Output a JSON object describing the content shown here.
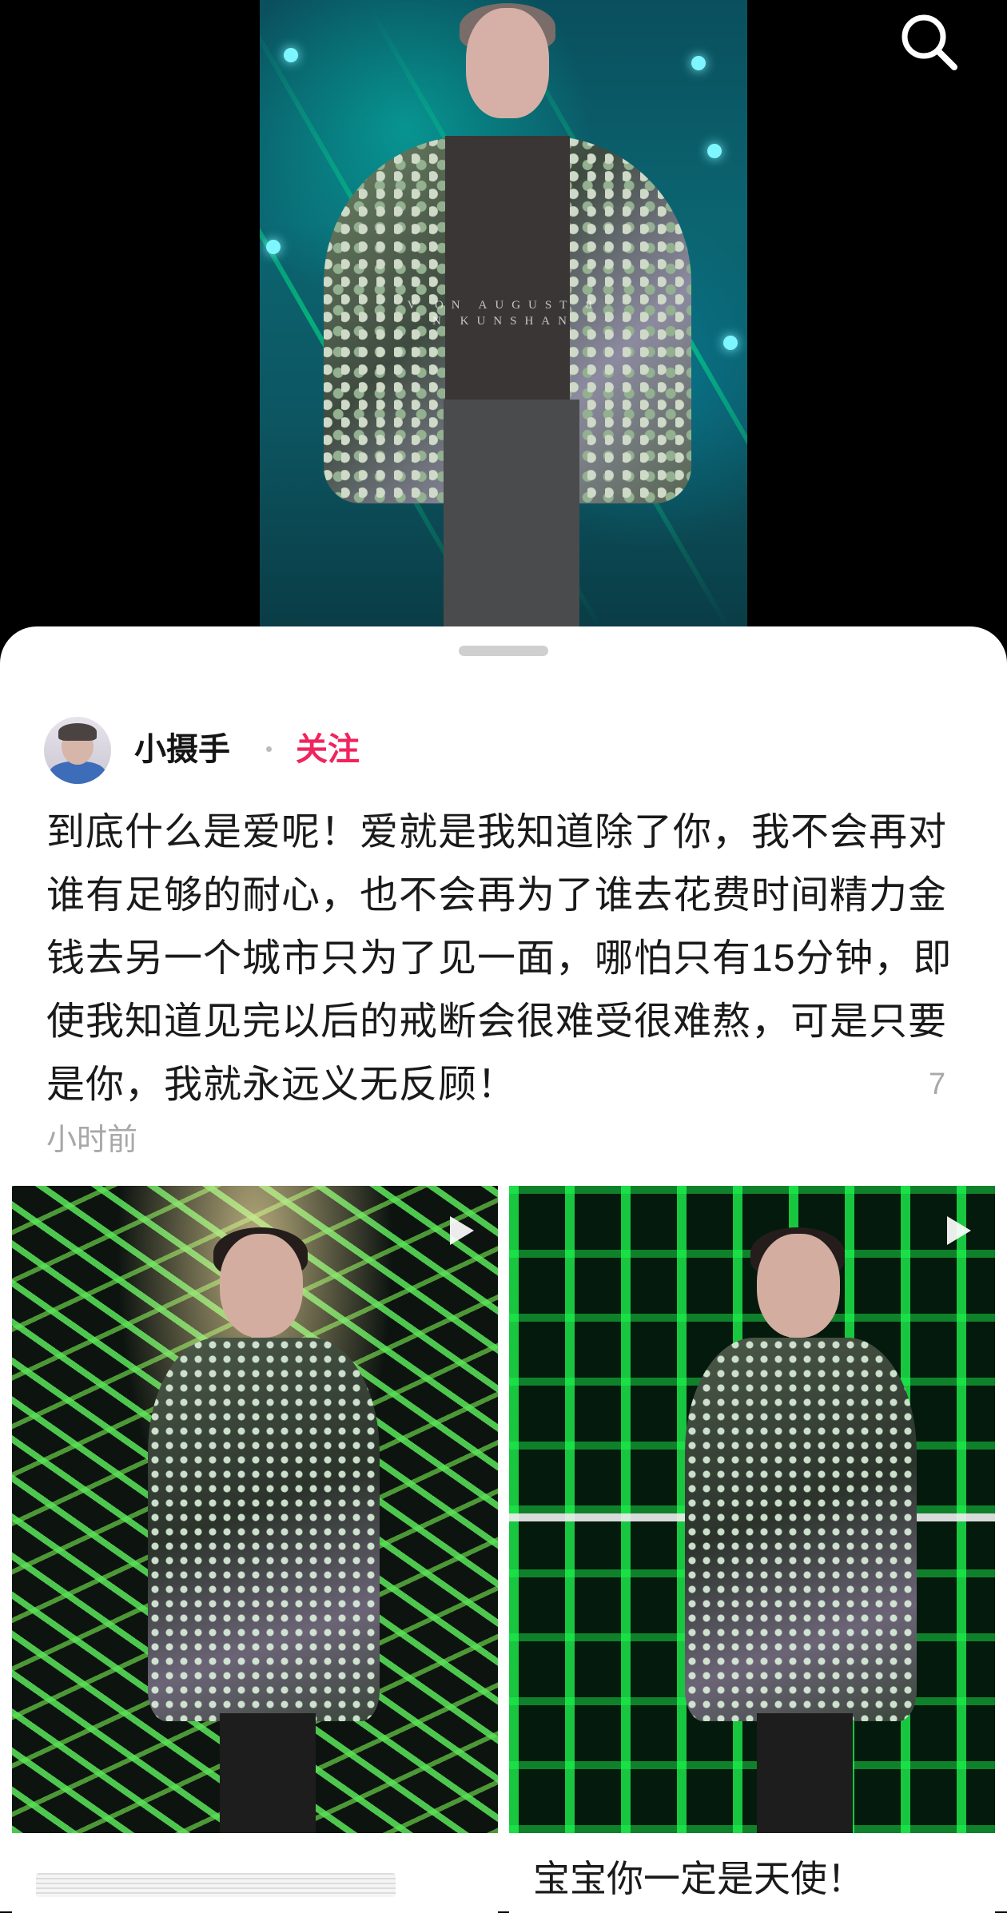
{
  "video": {
    "watermark_line1": "V    ON  AUGUST  8",
    "watermark_line2": "N  KUNSHAN",
    "search_icon": "search-icon"
  },
  "post": {
    "username": "小摄手",
    "follow_label": "关注",
    "text": "到底什么是爱呢！爱就是我知道除了你，我不会再对谁有足够的耐心，也不会再为了谁去花费时间精力金钱去另一个城市只为了见一面，哪怕只有15分钟，即使我知道见完以后的戒断会很难受很难熬，可是只要是你，我就永远义无反顾！",
    "time_num": "7",
    "time_suffix": "小时前"
  },
  "cards": [
    {
      "title": "",
      "play_icon": "play-icon"
    },
    {
      "title": "宝宝你一定是天使！",
      "play_icon": "play-icon"
    }
  ],
  "colors": {
    "follow": "#f0245c",
    "sheet_bg": "#ffffff",
    "muted_text": "#a8a8a8"
  }
}
